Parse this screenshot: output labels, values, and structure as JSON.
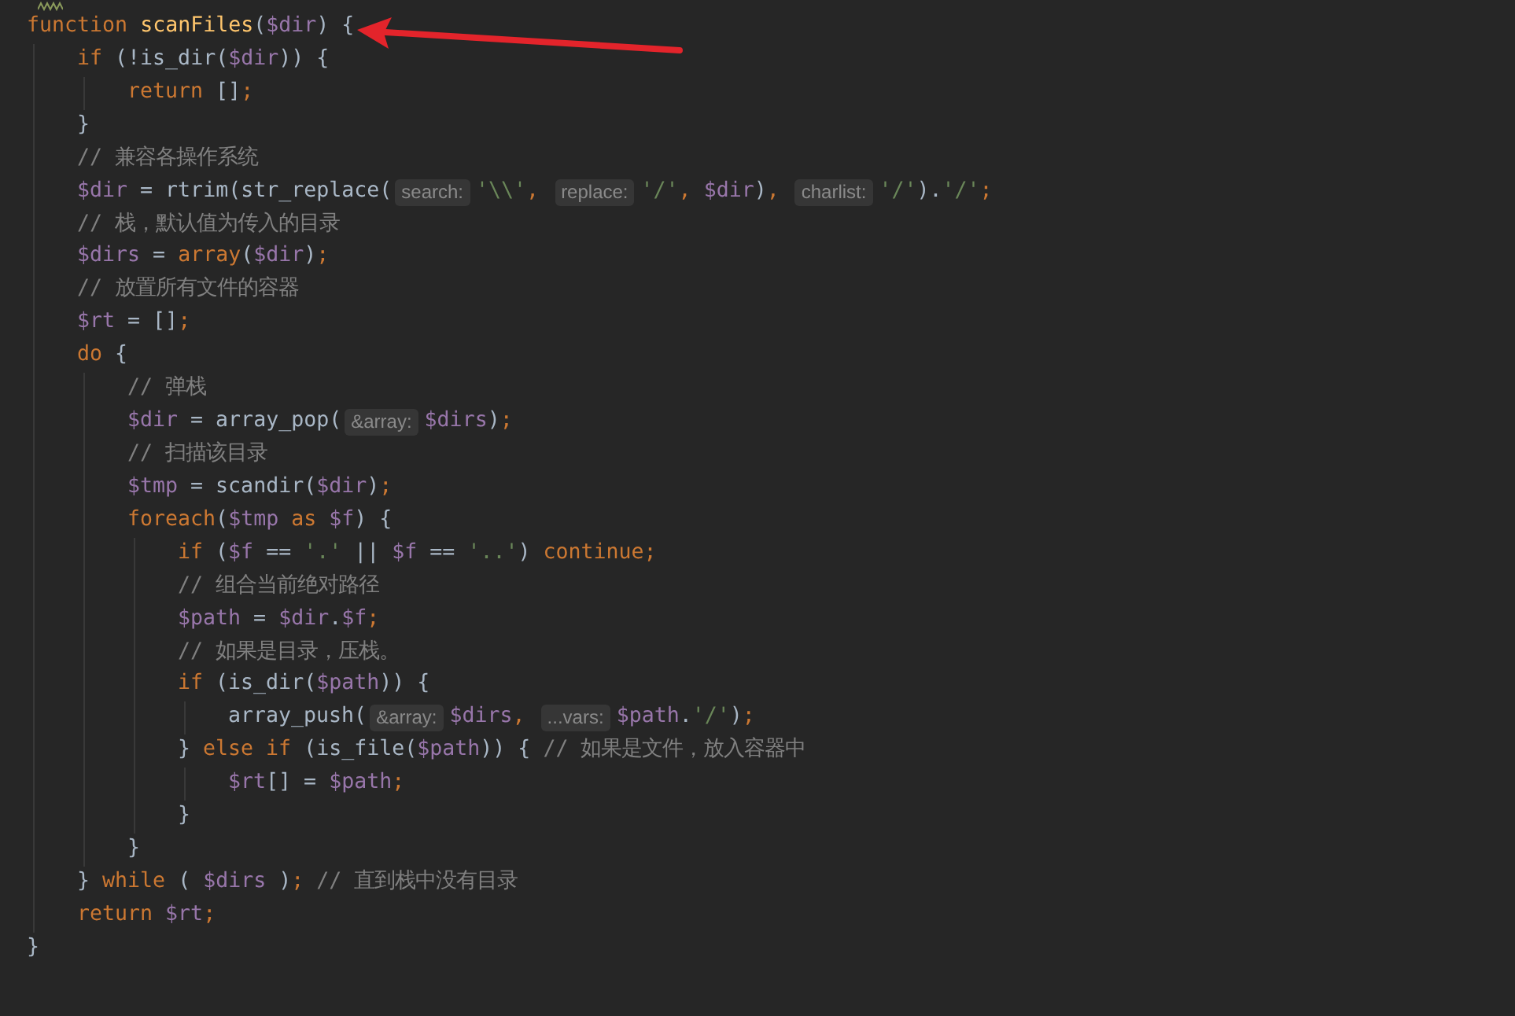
{
  "editor": {
    "lines": [
      {
        "tokens": [
          {
            "kind": "kw",
            "text": "function "
          },
          {
            "kind": "decl",
            "text": "scanFiles"
          },
          {
            "kind": "txt",
            "text": "("
          },
          {
            "kind": "var",
            "text": "$dir"
          },
          {
            "kind": "txt",
            "text": ") {"
          }
        ],
        "children": [
          {
            "tokens": [
              {
                "kind": "kw",
                "text": "if "
              },
              {
                "kind": "txt",
                "text": "(!is_dir("
              },
              {
                "kind": "var",
                "text": "$dir"
              },
              {
                "kind": "txt",
                "text": ")) {"
              }
            ],
            "children": [
              {
                "tokens": [
                  {
                    "kind": "kw",
                    "text": "return "
                  },
                  {
                    "kind": "txt",
                    "text": "[]"
                  },
                  {
                    "kind": "kw",
                    "text": ";"
                  }
                ]
              }
            ]
          },
          {
            "tokens": [
              {
                "kind": "txt",
                "text": "}"
              }
            ]
          },
          {
            "tokens": [
              {
                "kind": "cmt",
                "text": "// 兼容各操作系统"
              }
            ]
          },
          {
            "tokens": [
              {
                "kind": "var",
                "text": "$dir"
              },
              {
                "kind": "txt",
                "text": " = rtrim(str_replace("
              },
              {
                "kind": "hint",
                "text": "search:"
              },
              {
                "kind": "str",
                "text": "'\\\\'"
              },
              {
                "kind": "kw",
                "text": ", "
              },
              {
                "kind": "hint",
                "text": "replace:"
              },
              {
                "kind": "str",
                "text": "'/'"
              },
              {
                "kind": "kw",
                "text": ", "
              },
              {
                "kind": "var",
                "text": "$dir"
              },
              {
                "kind": "txt",
                "text": ")"
              },
              {
                "kind": "kw",
                "text": ", "
              },
              {
                "kind": "hint",
                "text": "charlist:"
              },
              {
                "kind": "str",
                "text": "'/'"
              },
              {
                "kind": "txt",
                "text": ")."
              },
              {
                "kind": "str",
                "text": "'/'"
              },
              {
                "kind": "kw",
                "text": ";"
              }
            ]
          },
          {
            "tokens": [
              {
                "kind": "cmt",
                "text": "// 栈，默认值为传入的目录"
              }
            ]
          },
          {
            "tokens": [
              {
                "kind": "var",
                "text": "$dirs"
              },
              {
                "kind": "txt",
                "text": " = "
              },
              {
                "kind": "kw",
                "text": "array"
              },
              {
                "kind": "txt",
                "text": "("
              },
              {
                "kind": "var",
                "text": "$dir"
              },
              {
                "kind": "txt",
                "text": ")"
              },
              {
                "kind": "kw",
                "text": ";"
              }
            ]
          },
          {
            "tokens": [
              {
                "kind": "cmt",
                "text": "// 放置所有文件的容器"
              }
            ]
          },
          {
            "tokens": [
              {
                "kind": "var",
                "text": "$rt"
              },
              {
                "kind": "txt",
                "text": " = []"
              },
              {
                "kind": "kw",
                "text": ";"
              }
            ]
          },
          {
            "tokens": [
              {
                "kind": "kw",
                "text": "do "
              },
              {
                "kind": "txt",
                "text": "{"
              }
            ],
            "children": [
              {
                "tokens": [
                  {
                    "kind": "cmt",
                    "text": "// 弹栈"
                  }
                ]
              },
              {
                "tokens": [
                  {
                    "kind": "var",
                    "text": "$dir"
                  },
                  {
                    "kind": "txt",
                    "text": " = array_pop("
                  },
                  {
                    "kind": "hint",
                    "text": "&array:"
                  },
                  {
                    "kind": "var",
                    "text": "$dirs"
                  },
                  {
                    "kind": "txt",
                    "text": ")"
                  },
                  {
                    "kind": "kw",
                    "text": ";"
                  }
                ]
              },
              {
                "tokens": [
                  {
                    "kind": "cmt",
                    "text": "// 扫描该目录"
                  }
                ]
              },
              {
                "tokens": [
                  {
                    "kind": "var",
                    "text": "$tmp"
                  },
                  {
                    "kind": "txt",
                    "text": " = scandir("
                  },
                  {
                    "kind": "var",
                    "text": "$dir"
                  },
                  {
                    "kind": "txt",
                    "text": ")"
                  },
                  {
                    "kind": "kw",
                    "text": ";"
                  }
                ]
              },
              {
                "tokens": [
                  {
                    "kind": "kw",
                    "text": "foreach"
                  },
                  {
                    "kind": "txt",
                    "text": "("
                  },
                  {
                    "kind": "var",
                    "text": "$tmp"
                  },
                  {
                    "kind": "kw",
                    "text": " as "
                  },
                  {
                    "kind": "var",
                    "text": "$f"
                  },
                  {
                    "kind": "txt",
                    "text": ") {"
                  }
                ],
                "children": [
                  {
                    "tokens": [
                      {
                        "kind": "kw",
                        "text": "if "
                      },
                      {
                        "kind": "txt",
                        "text": "("
                      },
                      {
                        "kind": "var",
                        "text": "$f"
                      },
                      {
                        "kind": "txt",
                        "text": " == "
                      },
                      {
                        "kind": "str",
                        "text": "'.'"
                      },
                      {
                        "kind": "txt",
                        "text": " || "
                      },
                      {
                        "kind": "var",
                        "text": "$f"
                      },
                      {
                        "kind": "txt",
                        "text": " == "
                      },
                      {
                        "kind": "str",
                        "text": "'..'"
                      },
                      {
                        "kind": "txt",
                        "text": ") "
                      },
                      {
                        "kind": "kw",
                        "text": "continue;"
                      }
                    ]
                  },
                  {
                    "tokens": [
                      {
                        "kind": "cmt",
                        "text": "// 组合当前绝对路径"
                      }
                    ]
                  },
                  {
                    "tokens": [
                      {
                        "kind": "var",
                        "text": "$path"
                      },
                      {
                        "kind": "txt",
                        "text": " = "
                      },
                      {
                        "kind": "var",
                        "text": "$dir"
                      },
                      {
                        "kind": "txt",
                        "text": "."
                      },
                      {
                        "kind": "var",
                        "text": "$f"
                      },
                      {
                        "kind": "kw",
                        "text": ";"
                      }
                    ]
                  },
                  {
                    "tokens": [
                      {
                        "kind": "cmt",
                        "text": "// 如果是目录，压栈。"
                      }
                    ]
                  },
                  {
                    "tokens": [
                      {
                        "kind": "kw",
                        "text": "if "
                      },
                      {
                        "kind": "txt",
                        "text": "(is_dir("
                      },
                      {
                        "kind": "var",
                        "text": "$path"
                      },
                      {
                        "kind": "txt",
                        "text": ")) {"
                      }
                    ],
                    "children": [
                      {
                        "tokens": [
                          {
                            "kind": "txt",
                            "text": "array_push("
                          },
                          {
                            "kind": "hint",
                            "text": "&array:"
                          },
                          {
                            "kind": "var",
                            "text": "$dirs"
                          },
                          {
                            "kind": "kw",
                            "text": ", "
                          },
                          {
                            "kind": "hint",
                            "text": "...vars:"
                          },
                          {
                            "kind": "var",
                            "text": "$path"
                          },
                          {
                            "kind": "txt",
                            "text": "."
                          },
                          {
                            "kind": "str",
                            "text": "'/'"
                          },
                          {
                            "kind": "txt",
                            "text": ")"
                          },
                          {
                            "kind": "kw",
                            "text": ";"
                          }
                        ]
                      }
                    ]
                  },
                  {
                    "tokens": [
                      {
                        "kind": "txt",
                        "text": "} "
                      },
                      {
                        "kind": "kw",
                        "text": "else if "
                      },
                      {
                        "kind": "txt",
                        "text": "(is_file("
                      },
                      {
                        "kind": "var",
                        "text": "$path"
                      },
                      {
                        "kind": "txt",
                        "text": ")) { "
                      },
                      {
                        "kind": "cmt",
                        "text": "// 如果是文件，放入容器中"
                      }
                    ],
                    "children": [
                      {
                        "tokens": [
                          {
                            "kind": "var",
                            "text": "$rt"
                          },
                          {
                            "kind": "txt",
                            "text": "[] = "
                          },
                          {
                            "kind": "var",
                            "text": "$path"
                          },
                          {
                            "kind": "kw",
                            "text": ";"
                          }
                        ]
                      }
                    ]
                  },
                  {
                    "tokens": [
                      {
                        "kind": "txt",
                        "text": "}"
                      }
                    ]
                  }
                ]
              },
              {
                "tokens": [
                  {
                    "kind": "txt",
                    "text": "}"
                  }
                ]
              }
            ]
          },
          {
            "tokens": [
              {
                "kind": "txt",
                "text": "} "
              },
              {
                "kind": "kw",
                "text": "while "
              },
              {
                "kind": "txt",
                "text": "( "
              },
              {
                "kind": "var",
                "text": "$dirs"
              },
              {
                "kind": "txt",
                "text": " )"
              },
              {
                "kind": "kw",
                "text": "; "
              },
              {
                "kind": "cmt",
                "text": "// 直到栈中没有目录"
              }
            ]
          },
          {
            "tokens": [
              {
                "kind": "kw",
                "text": "return "
              },
              {
                "kind": "var",
                "text": "$rt"
              },
              {
                "kind": "kw",
                "text": ";"
              }
            ]
          }
        ]
      },
      {
        "tokens": [
          {
            "kind": "txt",
            "text": "}"
          }
        ]
      }
    ]
  }
}
